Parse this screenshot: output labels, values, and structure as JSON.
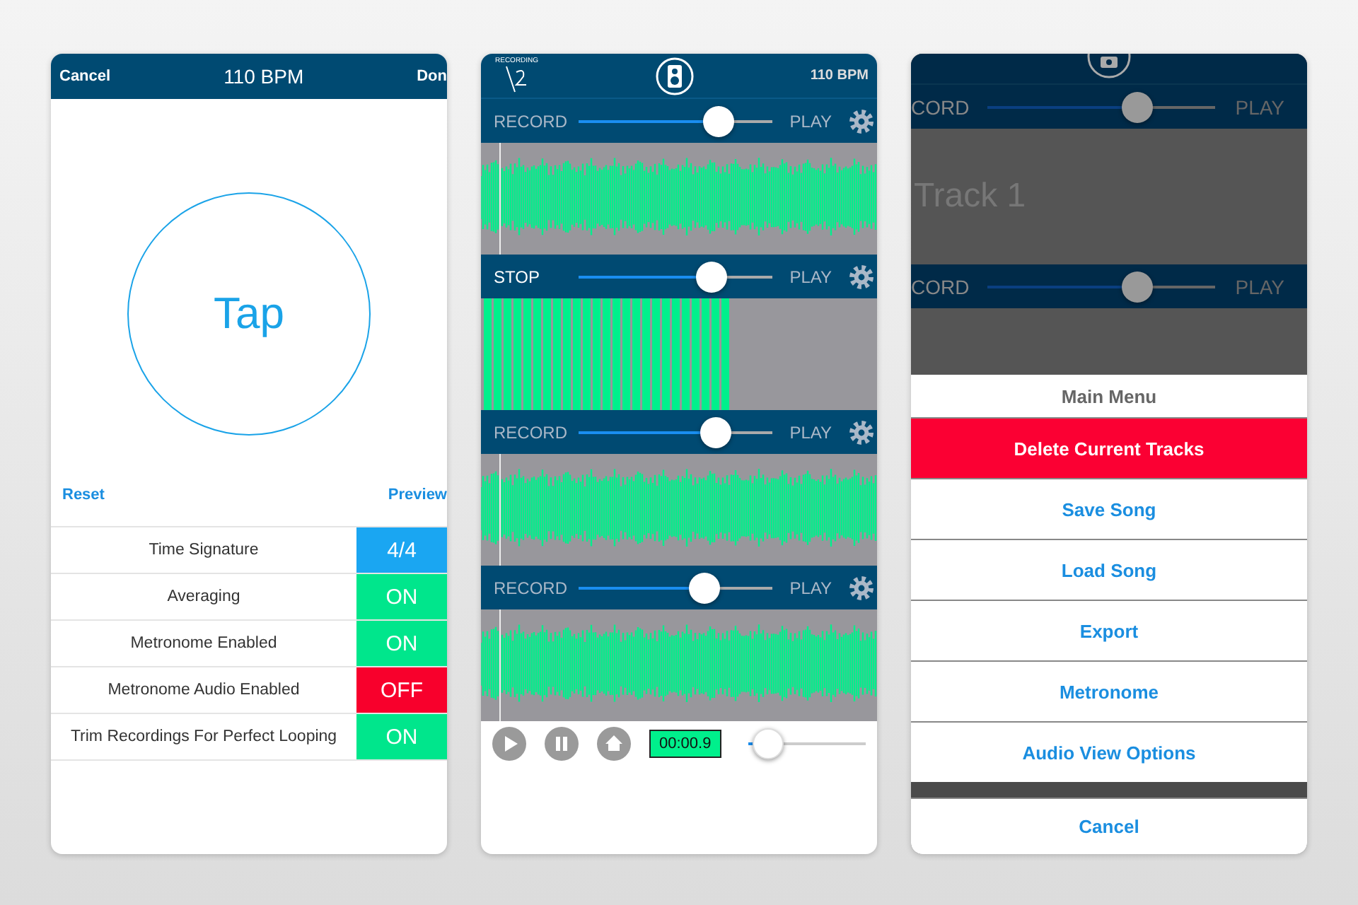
{
  "tempo_screen": {
    "header": {
      "cancel": "Cancel",
      "title": "110 BPM",
      "done": "Don"
    },
    "tap_label": "Tap",
    "reset": "Reset",
    "preview": "Preview",
    "settings": [
      {
        "label": "Time Signature",
        "value": "4/4",
        "kind": "choice"
      },
      {
        "label": "Averaging",
        "value": "ON",
        "kind": "toggle",
        "on": true
      },
      {
        "label": "Metronome Enabled",
        "value": "ON",
        "kind": "toggle",
        "on": true
      },
      {
        "label": "Metronome Audio Enabled",
        "value": "OFF",
        "kind": "toggle",
        "on": false
      },
      {
        "label": "Trim Recordings For Perfect Looping",
        "value": "ON",
        "kind": "toggle",
        "on": true
      }
    ]
  },
  "tracks_screen": {
    "header": {
      "logo_text": "RECORDING",
      "bpm": "110 BPM"
    },
    "tracks": [
      {
        "mode": "RECORD",
        "play": "PLAY",
        "level": 0.76,
        "recording": false,
        "kind": "waveform"
      },
      {
        "mode": "STOP",
        "play": "PLAY",
        "level": 0.72,
        "recording": true,
        "kind": "bars"
      },
      {
        "mode": "RECORD",
        "play": "PLAY",
        "level": 0.75,
        "recording": false,
        "kind": "waveform"
      },
      {
        "mode": "RECORD",
        "play": "PLAY",
        "level": 0.68,
        "recording": false,
        "kind": "waveform"
      }
    ],
    "transport": {
      "time": "00:00.9",
      "level": 0.06
    }
  },
  "menu_screen": {
    "tracks": [
      {
        "mode": "CORD",
        "play": "PLAY",
        "level": 0.68,
        "title": "Track 1"
      },
      {
        "mode": "CORD",
        "play": "PLAY",
        "level": 0.68
      }
    ],
    "menu": {
      "title": "Main Menu",
      "items": [
        {
          "label": "Delete Current Tracks",
          "kind": "destructive"
        },
        {
          "label": "Save Song",
          "kind": "normal"
        },
        {
          "label": "Load Song",
          "kind": "normal"
        },
        {
          "label": "Export",
          "kind": "normal"
        },
        {
          "label": "Metronome",
          "kind": "normal"
        },
        {
          "label": "Audio View Options",
          "kind": "normal"
        }
      ],
      "cancel": "Cancel"
    }
  }
}
